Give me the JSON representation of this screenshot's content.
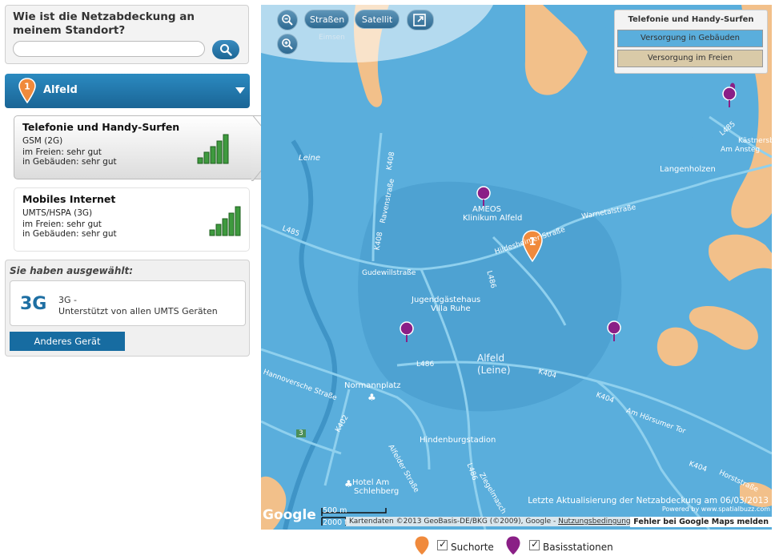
{
  "search": {
    "title": "Wie ist die Netzabdeckung an meinem Standort?",
    "input_value": "",
    "placeholder": "",
    "button_icon": "magnifier-icon"
  },
  "location": {
    "marker_number": "1",
    "name": "Alfeld"
  },
  "services": [
    {
      "title": "Telefonie und Handy-Surfen",
      "tech": "GSM (2G)",
      "outdoor": "im Freien: sehr gut",
      "indoor": "in Gebäuden: sehr gut",
      "bars": 5
    },
    {
      "title": "Mobiles Internet",
      "tech": "UMTS/HSPA (3G)",
      "outdoor": "im Freien: sehr gut",
      "indoor": "in Gebäuden: sehr gut",
      "bars": 5
    }
  ],
  "selected": {
    "heading": "Sie haben ausgewählt:",
    "badge": "3G",
    "line1": "3G -",
    "line2": "Unterstützt von allen UMTS Geräten",
    "button": "Anderes Gerät"
  },
  "map": {
    "buttons": {
      "streets": "Straßen",
      "satellite": "Satellit"
    },
    "legend": {
      "title": "Telefonie und Handy-Surfen",
      "indoor": "Versorgung in Gebäuden",
      "outdoor": "Versorgung im Freien"
    },
    "labels": {
      "town": "Alfeld",
      "town_sub": "(Leine)",
      "clinic1": "AMEOS",
      "clinic2": "Klinikum Alfeld",
      "langenholzen": "Langenholzen",
      "jugend1": "Jugendgästehaus",
      "jugend2": "Villa Ruhe",
      "normannplatz": "Normannplatz",
      "hindenburg": "Hindenburgstadion",
      "hotel1": "Hotel Am",
      "hotel2": "Schlehberg",
      "leine": "Leine",
      "eimsen": "Eimsen",
      "am_ansteg": "Am Ansteg",
      "kaestners": "Kästnersb"
    },
    "roads": {
      "k408a": "K408",
      "k408b": "K408",
      "ravensstr": "Ravenstraße",
      "l485a": "L485",
      "l485b": "L485",
      "warne": "Warnetalstraße",
      "hildesheimer": "Hildesheimer Straße",
      "gudewill": "Gudewillstraße",
      "l486a": "L486",
      "l486b": "L486",
      "l486c": "L486",
      "k404a": "K404",
      "k404b": "K404",
      "k404c": "K404",
      "hannoversche": "Hannoversche Straße",
      "k402": "K402",
      "alfelder": "Alfelder Straße",
      "am_horsumer": "Am Hörsumer Tor",
      "horststr": "Horststraße",
      "zieg": "Ziegelmasch",
      "three": "3"
    },
    "update": "Letzte Aktualisierung der Netzabdeckung am 06/03/2013",
    "powered": "Powered by www.spatialbuzz.com",
    "google": "Google",
    "scale_m": "500 m",
    "scale_ft": "2000 ft",
    "copyright": "Kartendaten ©2013 GeoBasis-DE/BKG (©2009), Google - ",
    "terms": "Nutzungsbedingungen",
    "report": "Fehler bei Google Maps melden",
    "search_marker_number": "1"
  },
  "bottom_legend": {
    "search_label": "Suchorte",
    "station_label": "Basisstationen"
  },
  "colors": {
    "accent": "#1c6d9e",
    "map_blue": "#5aaedc",
    "coverage_orange": "#f2c08a",
    "station_purple": "#8a1f86",
    "search_orange": "#f08a3c"
  }
}
